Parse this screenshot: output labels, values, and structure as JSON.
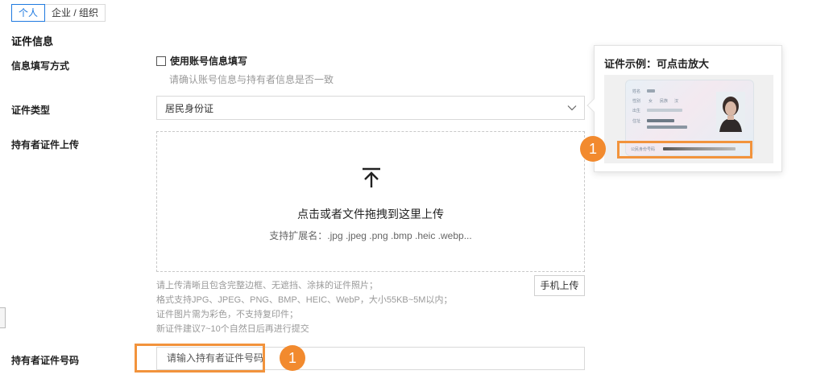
{
  "tabs": [
    {
      "label": "个人",
      "active": true
    },
    {
      "label": "企业 / 组织",
      "active": false
    }
  ],
  "section_title": "证件信息",
  "fill_method": {
    "label": "信息填写方式",
    "checkbox_label": "使用账号信息填写",
    "checked": false,
    "hint": "请确认账号信息与持有者信息是否一致"
  },
  "id_type": {
    "label": "证件类型",
    "value": "居民身份证"
  },
  "upload": {
    "label": "持有者证件上传",
    "title": "点击或者文件拖拽到这里上传",
    "extensions": "支持扩展名：.jpg .jpeg .png .bmp .heic .webp...",
    "notes": [
      "请上传清晰且包含完整边框、无遮挡、涂抹的证件照片；",
      "格式支持JPG、JPEG、PNG、BMP、HEIC、WebP，大小55KB~5M以内；",
      "证件图片需为彩色，不支持复印件；",
      "新证件建议7~10个自然日后再进行提交"
    ],
    "mobile_button": "手机上传"
  },
  "id_number": {
    "label": "持有者证件号码",
    "placeholder": "请输入持有者证件号码"
  },
  "popover": {
    "title": "证件示例：可点击放大",
    "card_labels": [
      "姓名",
      "性别",
      "民族",
      "出生",
      "住址",
      "公民身份号码"
    ],
    "card_values": [
      "女",
      "汉"
    ]
  },
  "callouts": [
    "1",
    "1"
  ],
  "colors": {
    "accent": "#1f7ae0",
    "callout": "#f28a2e"
  }
}
